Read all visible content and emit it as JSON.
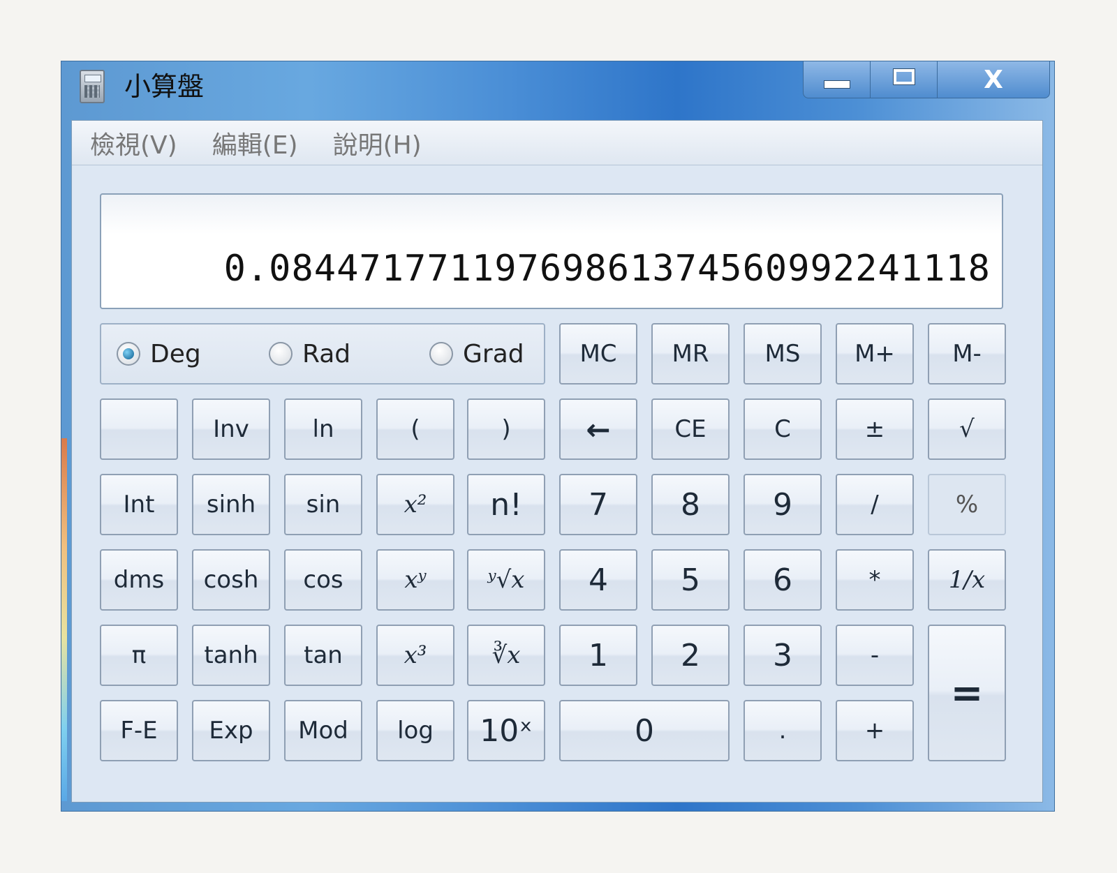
{
  "window": {
    "title": "小算盤",
    "close_label": "X"
  },
  "menu": [
    "檢視(V)",
    "編輯(E)",
    "說明(H)"
  ],
  "display": {
    "value": "0.08447177119769861374560992241118"
  },
  "angle_modes": {
    "deg": "Deg",
    "rad": "Rad",
    "grad": "Grad",
    "selected": "Deg"
  },
  "memory": [
    "MC",
    "MR",
    "MS",
    "M+",
    "M-"
  ],
  "row2": [
    "",
    "Inv",
    "ln",
    "(",
    ")",
    "←",
    "CE",
    "C",
    "±",
    "√"
  ],
  "row3": [
    "Int",
    "sinh",
    "sin",
    "x²",
    "n!",
    "7",
    "8",
    "9",
    "/",
    "%"
  ],
  "row4": [
    "dms",
    "cosh",
    "cos",
    "xʸ",
    "ʸ√x",
    "4",
    "5",
    "6",
    "*",
    "1/x"
  ],
  "row5": [
    "π",
    "tanh",
    "tan",
    "x³",
    "∛x",
    "1",
    "2",
    "3",
    "-",
    "="
  ],
  "row6": [
    "F-E",
    "Exp",
    "Mod",
    "log",
    "10ˣ",
    "0",
    ".",
    "+"
  ]
}
